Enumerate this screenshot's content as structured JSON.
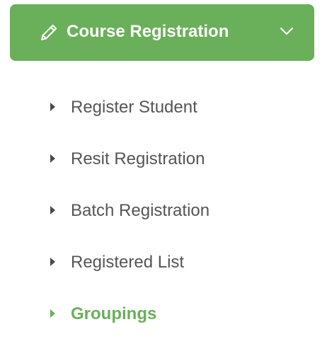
{
  "menu": {
    "title": "Course Registration",
    "icon": "pencil-icon",
    "expand_icon": "chevron-down-icon",
    "accent_color": "#6aaf5a",
    "items": [
      {
        "label": "Register Student",
        "active": false
      },
      {
        "label": "Resit Registration",
        "active": false
      },
      {
        "label": "Batch Registration",
        "active": false
      },
      {
        "label": "Registered List",
        "active": false
      },
      {
        "label": "Groupings",
        "active": true
      }
    ]
  }
}
